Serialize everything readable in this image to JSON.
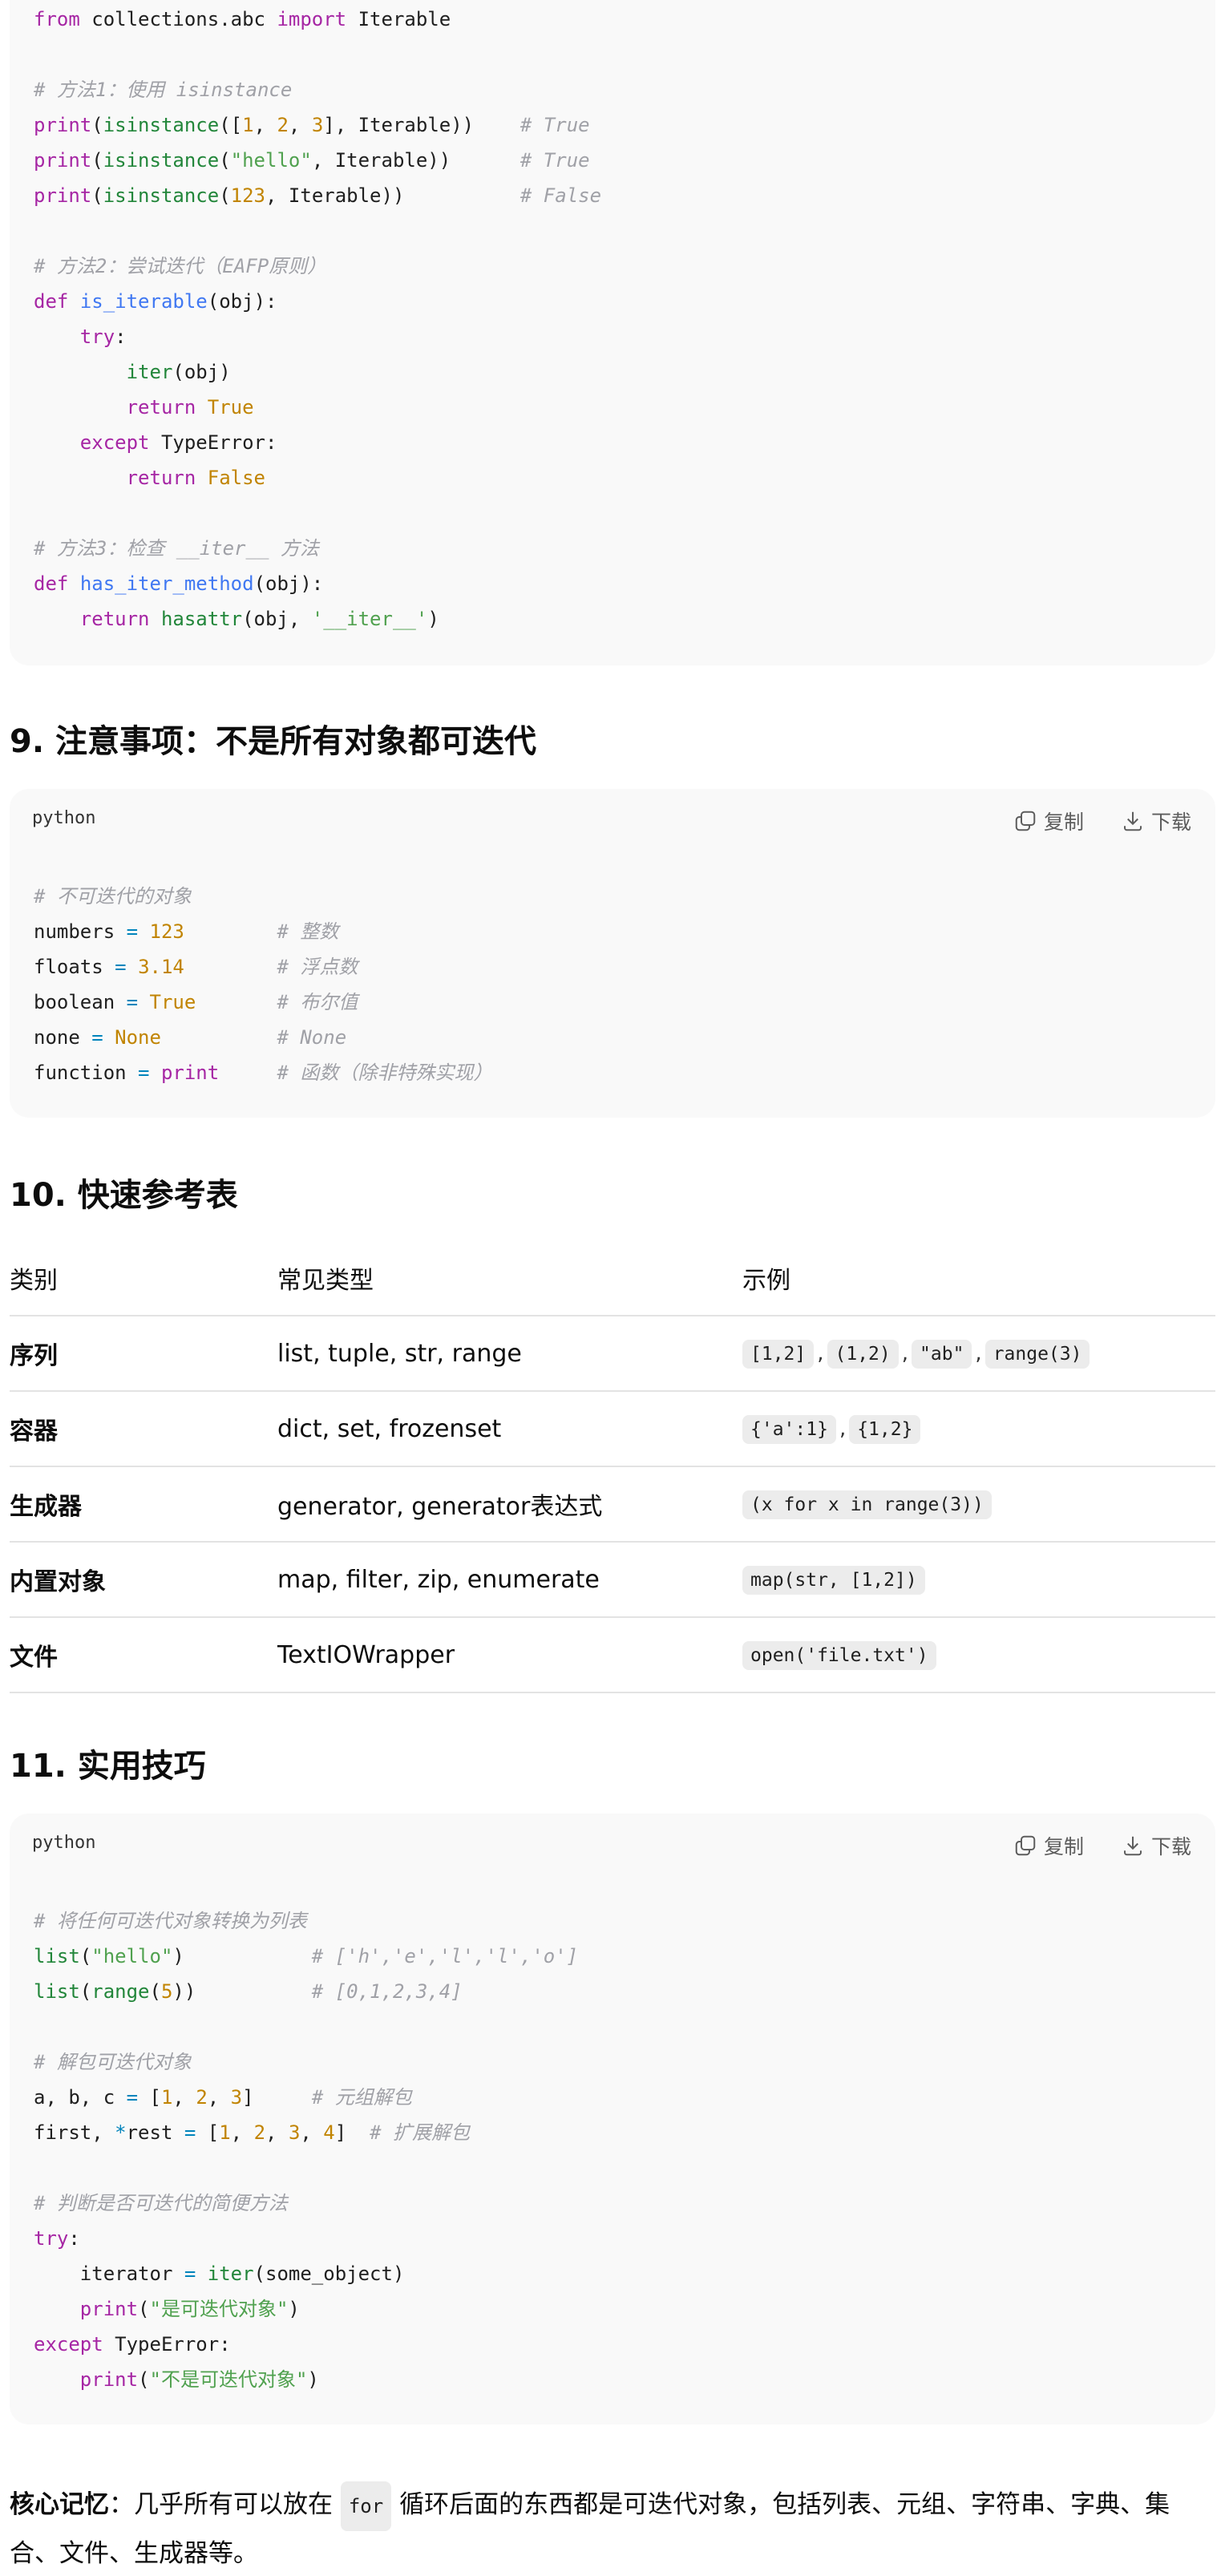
{
  "headings": {
    "h9": "9. 注意事项：不是所有对象都可迭代",
    "h10": "10. 快速参考表",
    "h11": "11. 实用技巧"
  },
  "code_block": {
    "lang": "python",
    "copy_label": "复制",
    "download_label": "下载"
  },
  "code1": {
    "l1": [
      "from",
      " collections.abc ",
      "import",
      " Iterable"
    ],
    "l3": "# 方法1：使用 isinstance",
    "l4": [
      "print",
      "(",
      "isinstance",
      "([",
      "1",
      ", ",
      "2",
      ", ",
      "3",
      "], Iterable))    ",
      "# True"
    ],
    "l5": [
      "print",
      "(",
      "isinstance",
      "(",
      "\"hello\"",
      ", Iterable))      ",
      "# True"
    ],
    "l6": [
      "print",
      "(",
      "isinstance",
      "(",
      "123",
      ", Iterable))          ",
      "# False"
    ],
    "l8": "# 方法2：尝试迭代（EAFP原则）",
    "l9": [
      "def",
      " ",
      "is_iterable",
      "(obj):"
    ],
    "l10": [
      "    ",
      "try",
      ":"
    ],
    "l11": [
      "        ",
      "iter",
      "(obj)"
    ],
    "l12": [
      "        ",
      "return",
      " ",
      "True"
    ],
    "l13": [
      "    ",
      "except",
      " TypeError:"
    ],
    "l14": [
      "        ",
      "return",
      " ",
      "False"
    ],
    "l16": "# 方法3：检查 __iter__ 方法",
    "l17": [
      "def",
      " ",
      "has_iter_method",
      "(obj):"
    ],
    "l18": [
      "    ",
      "return",
      " ",
      "hasattr",
      "(obj, ",
      "'__iter__'",
      ")"
    ]
  },
  "code2": {
    "l1": "# 不可迭代的对象",
    "l2": [
      "numbers ",
      "=",
      " ",
      "123",
      "        ",
      "# 整数"
    ],
    "l3": [
      "floats ",
      "=",
      " ",
      "3.14",
      "        ",
      "# 浮点数"
    ],
    "l4": [
      "boolean ",
      "=",
      " ",
      "True",
      "       ",
      "# 布尔值"
    ],
    "l5": [
      "none ",
      "=",
      " ",
      "None",
      "          ",
      "# None"
    ],
    "l6": [
      "function ",
      "=",
      " ",
      "print",
      "     ",
      "# 函数（除非特殊实现）"
    ]
  },
  "table": {
    "headers": [
      "类别",
      "常见类型",
      "示例"
    ],
    "rows": [
      {
        "cat": "序列",
        "types": "list, tuple, str, range",
        "ex": [
          "[1,2]",
          "(1,2)",
          "\"ab\"",
          "range(3)"
        ]
      },
      {
        "cat": "容器",
        "types": "dict, set, frozenset",
        "ex": [
          "{'a':1}",
          "{1,2}"
        ]
      },
      {
        "cat": "生成器",
        "types": "generator, generator表达式",
        "ex": [
          "(x for x in range(3))"
        ]
      },
      {
        "cat": "内置对象",
        "types": "map, filter, zip, enumerate",
        "ex": [
          "map(str, [1,2])"
        ]
      },
      {
        "cat": "文件",
        "types": "TextIOWrapper",
        "ex": [
          "open('file.txt')"
        ]
      }
    ],
    "sep": ","
  },
  "code3": {
    "l1": "# 将任何可迭代对象转换为列表",
    "l2": [
      "list",
      "(",
      "\"hello\"",
      ")           ",
      "# ['h','e','l','l','o']"
    ],
    "l3": [
      "list",
      "(",
      "range",
      "(",
      "5",
      "))          ",
      "# [0,1,2,3,4]"
    ],
    "l5": "# 解包可迭代对象",
    "l6": [
      "a, b, c ",
      "=",
      " [",
      "1",
      ", ",
      "2",
      ", ",
      "3",
      "]     ",
      "# 元组解包"
    ],
    "l7": [
      "first, ",
      "*",
      "rest ",
      "=",
      " [",
      "1",
      ", ",
      "2",
      ", ",
      "3",
      ", ",
      "4",
      "]  ",
      "# 扩展解包"
    ],
    "l9": "# 判断是否可迭代的简便方法",
    "l10": [
      "try",
      ":"
    ],
    "l11": [
      "    iterator ",
      "=",
      " ",
      "iter",
      "(some_object)"
    ],
    "l12": [
      "    ",
      "print",
      "(",
      "\"是可迭代对象\"",
      ")"
    ],
    "l13": [
      "except",
      " TypeError:"
    ],
    "l14": [
      "    ",
      "print",
      "(",
      "\"不是可迭代对象\"",
      ")"
    ]
  },
  "footer": {
    "bold": "核心记忆",
    "pre": "：几乎所有可以放在 ",
    "code": "for",
    "post": " 循环后面的东西都是可迭代对象，包括列表、元组、字符串、字典、集合、文件、生成器等。"
  },
  "colors": {
    "code_bg": "#f9f9f9",
    "keyword": "#a626a4",
    "function": "#4078f2",
    "builtin": "#22863a",
    "number": "#c18401",
    "string": "#50a14f",
    "comment": "#a0a1a7"
  },
  "icons": [
    "copy-icon",
    "download-icon"
  ]
}
